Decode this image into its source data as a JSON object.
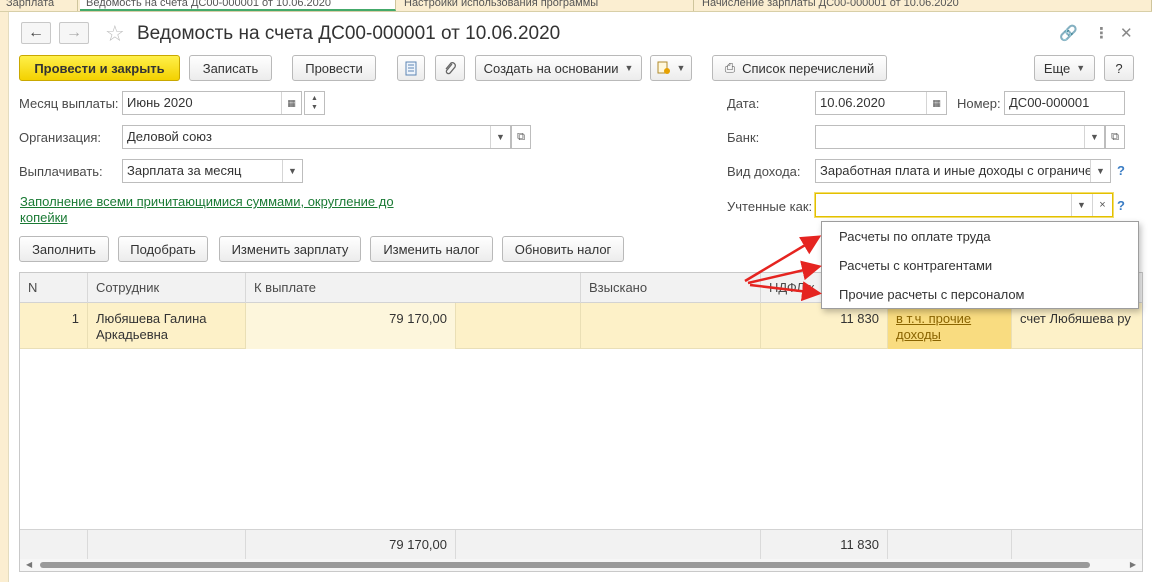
{
  "tabs": [
    {
      "label": "Зарплата"
    },
    {
      "label": "Ведомость на счета ДС00-000001 от 10.06.2020"
    },
    {
      "label": "Настройки использования программы"
    },
    {
      "label": "Начисление зарплаты ДС00-000001 от 10.06.2020"
    }
  ],
  "window": {
    "title": "Ведомость на счета ДС00-000001 от 10.06.2020"
  },
  "toolbar": {
    "post_close": "Провести и закрыть",
    "save": "Записать",
    "post": "Провести",
    "create_based": "Создать на основании",
    "transfer_list": "Список перечислений",
    "more": "Еще",
    "help": "?"
  },
  "form": {
    "month_label": "Месяц выплаты:",
    "month_value": "Июнь 2020",
    "org_label": "Организация:",
    "org_value": "Деловой союз",
    "pay_label": "Выплачивать:",
    "pay_value": "Зарплата за месяц",
    "date_label": "Дата:",
    "date_value": "10.06.2020",
    "number_label": "Номер:",
    "number_value": "ДС00-000001",
    "bank_label": "Банк:",
    "bank_value": "",
    "income_label": "Вид дохода:",
    "income_value": "Заработная плата и иные доходы с ограничени",
    "accounted_label": "Учтенные как:",
    "accounted_value": "",
    "fill_link": "Заполнение всеми причитающимися суммами, округление до копейки"
  },
  "actions": {
    "fill": "Заполнить",
    "pick": "Подобрать",
    "change_salary": "Изменить зарплату",
    "change_tax": "Изменить налог",
    "update_tax": "Обновить налог"
  },
  "table": {
    "columns": [
      "N",
      "Сотрудник",
      "К выплате",
      "Взыскано",
      "НДФЛ к"
    ],
    "rows": [
      {
        "n": "1",
        "employee": "Любяшева Галина Аркадьевна",
        "to_pay": "79 170,00",
        "withheld": "",
        "ndfl": "11 830",
        "incl_link": "в т.ч. прочие доходы",
        "account": "счет Любяшева ру"
      }
    ],
    "totals": {
      "to_pay": "79 170,00",
      "ndfl": "11 830"
    }
  },
  "popup": {
    "items": [
      "Расчеты по оплате труда",
      "Расчеты с контрагентами",
      "Прочие расчеты с персоналом"
    ]
  },
  "colors": {
    "primary_button": "#f3d100",
    "selected_row": "#fdf1c8",
    "link": "#1a7a34",
    "arrow": "#e52420"
  }
}
